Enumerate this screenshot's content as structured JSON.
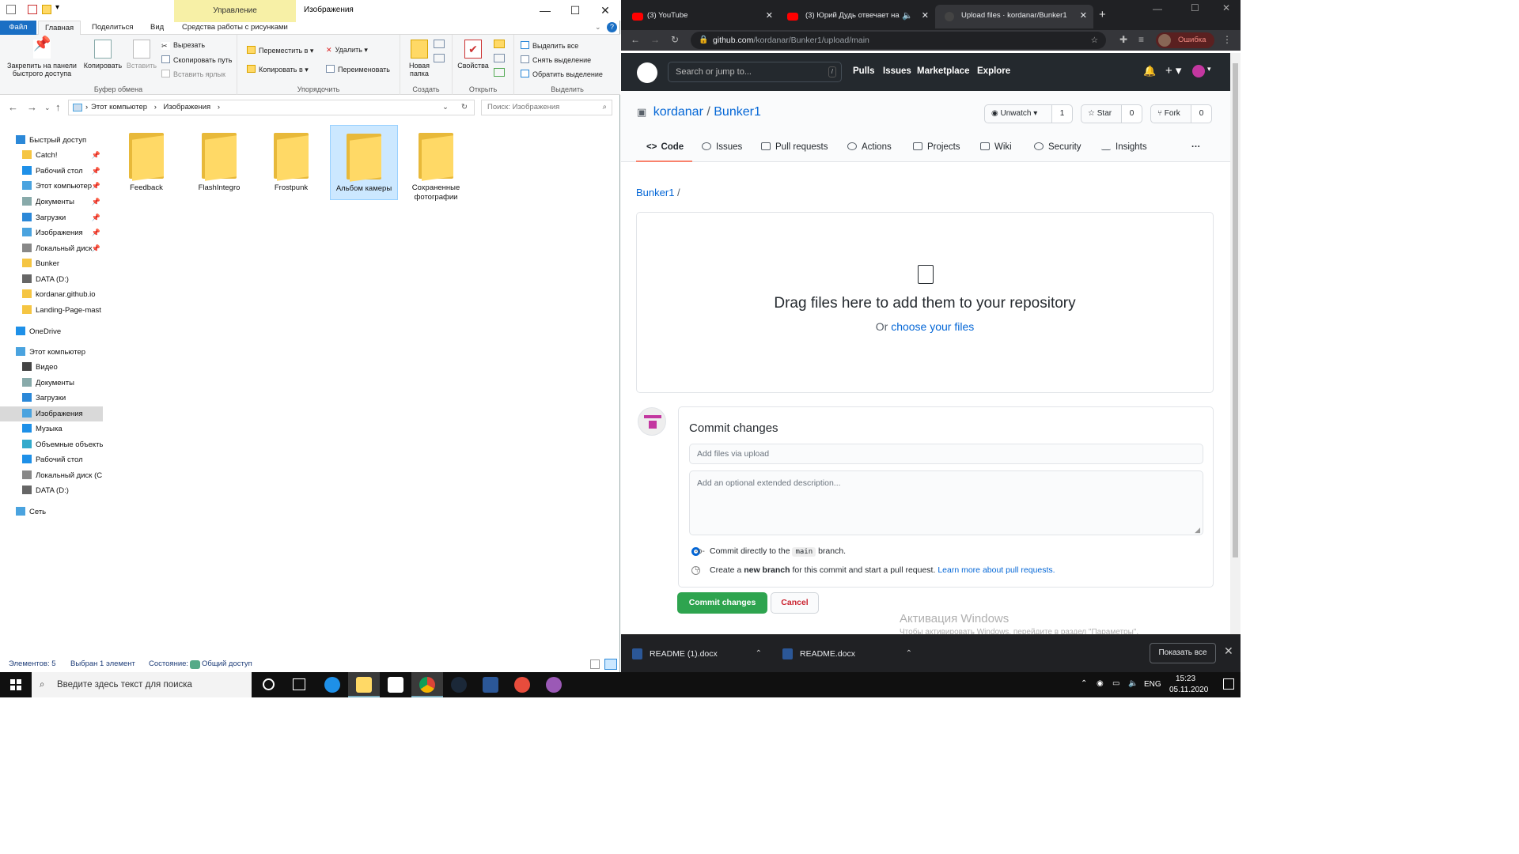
{
  "explorer": {
    "window_title": "Изображения",
    "manage_tab": "Управление",
    "tabs": [
      "Файл",
      "Главная",
      "Поделиться",
      "Вид",
      "Средства работы с рисунками"
    ],
    "ribbon": {
      "pin_label": "Закрепить на панели быстрого доступа",
      "copy_label": "Копировать",
      "paste_label": "Вставить",
      "cut_label": "Вырезать",
      "copy_path_label": "Скопировать путь",
      "paste_shortcut_label": "Вставить ярлык",
      "group_clipboard": "Буфер обмена",
      "move_to_label": "Переместить в",
      "copy_to_label": "Копировать в",
      "delete_label": "Удалить",
      "rename_label": "Переименовать",
      "group_organize": "Упорядочить",
      "new_folder_label": "Новая папка",
      "group_create": "Создать",
      "properties_label": "Свойства",
      "group_open": "Открыть",
      "select_all_label": "Выделить все",
      "select_none_label": "Снять выделение",
      "invert_label": "Обратить выделение",
      "group_select": "Выделить"
    },
    "address": {
      "crumb1": "Этот компьютер",
      "crumb2": "Изображения",
      "search_placeholder": "Поиск: Изображения"
    },
    "nav": [
      {
        "label": "Быстрый доступ",
        "pinned": false,
        "color": "#2b88d8"
      },
      {
        "label": "Catch!",
        "pinned": true,
        "color": "#f5c542"
      },
      {
        "label": "Рабочий стол",
        "pinned": true,
        "color": "#1e90e8"
      },
      {
        "label": "Этот компьютер",
        "pinned": true,
        "color": "#4aa3df"
      },
      {
        "label": "Документы",
        "pinned": true,
        "color": "#8aa"
      },
      {
        "label": "Загрузки",
        "pinned": true,
        "color": "#2b88d8"
      },
      {
        "label": "Изображения",
        "pinned": true,
        "color": "#4aa3df"
      },
      {
        "label": "Локальный диск",
        "pinned": true,
        "color": "#888"
      },
      {
        "label": "Bunker",
        "pinned": false,
        "color": "#f5c542"
      },
      {
        "label": "DATA (D:)",
        "pinned": false,
        "color": "#666"
      },
      {
        "label": "kordanar.github.io",
        "pinned": false,
        "color": "#f5c542"
      },
      {
        "label": "Landing-Page-mast",
        "pinned": false,
        "color": "#f5c542"
      },
      {
        "label": "OneDrive",
        "pinned": false,
        "color": "#1e90e8"
      },
      {
        "label": "Этот компьютер",
        "pinned": false,
        "color": "#4aa3df"
      },
      {
        "label": "Видео",
        "pinned": false,
        "color": "#444"
      },
      {
        "label": "Документы",
        "pinned": false,
        "color": "#8aa"
      },
      {
        "label": "Загрузки",
        "pinned": false,
        "color": "#2b88d8"
      },
      {
        "label": "Изображения",
        "pinned": false,
        "color": "#4aa3df"
      },
      {
        "label": "Музыка",
        "pinned": false,
        "color": "#1e90e8"
      },
      {
        "label": "Объемные объекты",
        "pinned": false,
        "color": "#3ac"
      },
      {
        "label": "Рабочий стол",
        "pinned": false,
        "color": "#1e90e8"
      },
      {
        "label": "Локальный диск (C",
        "pinned": false,
        "color": "#888"
      },
      {
        "label": "DATA (D:)",
        "pinned": false,
        "color": "#666"
      },
      {
        "label": "Сеть",
        "pinned": false,
        "color": "#4aa3df"
      }
    ],
    "files": [
      {
        "name": "Feedback",
        "selected": false
      },
      {
        "name": "FlashIntegro",
        "selected": false
      },
      {
        "name": "Frostpunk",
        "selected": false
      },
      {
        "name": "Альбом камеры",
        "selected": true
      },
      {
        "name": "Сохраненные фотографии",
        "selected": false
      }
    ],
    "status": {
      "count": "Элементов: 5",
      "selected": "Выбран 1 элемент",
      "state": "Состояние:",
      "shared": "Общий доступ"
    }
  },
  "browser": {
    "tabs": [
      {
        "title": "(3) YouTube",
        "active": false,
        "favicon": "youtube-icon"
      },
      {
        "title": "(3) Юрий Дудь отвечает на",
        "active": false,
        "favicon": "youtube-icon"
      },
      {
        "title": "Upload files · kordanar/Bunker1",
        "active": true,
        "favicon": "github-icon"
      }
    ],
    "url_host": "github.com",
    "url_path": "/kordanar/Bunker1/upload/main",
    "profile_error": "Ошибка",
    "github": {
      "search_placeholder": "Search or jump to...",
      "search_key": "/",
      "nav": [
        "Pulls",
        "Issues",
        "Marketplace",
        "Explore"
      ],
      "owner": "kordanar",
      "repo": "Bunker1",
      "unwatch": "Unwatch",
      "unwatch_count": "1",
      "star": "Star",
      "star_count": "0",
      "fork": "Fork",
      "fork_count": "0",
      "tabs": [
        "Code",
        "Issues",
        "Pull requests",
        "Actions",
        "Projects",
        "Wiki",
        "Security",
        "Insights"
      ],
      "more": "···",
      "breadcrumb_repo": "Bunker1",
      "breadcrumb_sep": "/",
      "drop_title": "Drag files here to add them to your repository",
      "drop_or": "Or",
      "drop_link": "choose your files",
      "commit_title": "Commit changes",
      "summary_placeholder": "Add files via upload",
      "desc_placeholder": "Add an optional extended description...",
      "radio1_pre": "Commit directly to the",
      "radio1_branch": "main",
      "radio1_post": "branch.",
      "radio2_pre": "Create a",
      "radio2_bold": "new branch",
      "radio2_post": "for this commit and start a pull request.",
      "radio2_link": "Learn more about pull requests.",
      "commit_button": "Commit changes",
      "cancel_button": "Cancel"
    },
    "watermark": {
      "title": "Активация Windows",
      "sub": "Чтобы активировать Windows, перейдите в раздел \"Параметры\"."
    },
    "downloads": [
      {
        "name": "README (1).docx"
      },
      {
        "name": "README.docx"
      }
    ],
    "show_all": "Показать все"
  },
  "taskbar": {
    "search_placeholder": "Введите здесь текст для поиска",
    "lang": "ENG",
    "time": "15:23",
    "date": "05.11.2020"
  }
}
